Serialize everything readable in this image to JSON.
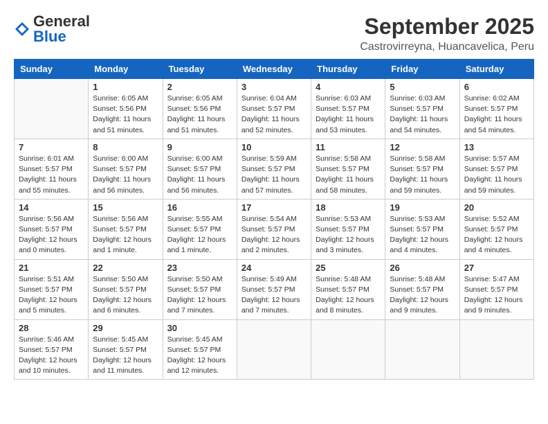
{
  "logo": {
    "general": "General",
    "blue": "Blue"
  },
  "header": {
    "month": "September 2025",
    "location": "Castrovirreyna, Huancavelica, Peru"
  },
  "weekdays": [
    "Sunday",
    "Monday",
    "Tuesday",
    "Wednesday",
    "Thursday",
    "Friday",
    "Saturday"
  ],
  "weeks": [
    [
      {
        "day": "",
        "info": ""
      },
      {
        "day": "1",
        "info": "Sunrise: 6:05 AM\nSunset: 5:56 PM\nDaylight: 11 hours\nand 51 minutes."
      },
      {
        "day": "2",
        "info": "Sunrise: 6:05 AM\nSunset: 5:56 PM\nDaylight: 11 hours\nand 51 minutes."
      },
      {
        "day": "3",
        "info": "Sunrise: 6:04 AM\nSunset: 5:57 PM\nDaylight: 11 hours\nand 52 minutes."
      },
      {
        "day": "4",
        "info": "Sunrise: 6:03 AM\nSunset: 5:57 PM\nDaylight: 11 hours\nand 53 minutes."
      },
      {
        "day": "5",
        "info": "Sunrise: 6:03 AM\nSunset: 5:57 PM\nDaylight: 11 hours\nand 54 minutes."
      },
      {
        "day": "6",
        "info": "Sunrise: 6:02 AM\nSunset: 5:57 PM\nDaylight: 11 hours\nand 54 minutes."
      }
    ],
    [
      {
        "day": "7",
        "info": "Sunrise: 6:01 AM\nSunset: 5:57 PM\nDaylight: 11 hours\nand 55 minutes."
      },
      {
        "day": "8",
        "info": "Sunrise: 6:00 AM\nSunset: 5:57 PM\nDaylight: 11 hours\nand 56 minutes."
      },
      {
        "day": "9",
        "info": "Sunrise: 6:00 AM\nSunset: 5:57 PM\nDaylight: 11 hours\nand 56 minutes."
      },
      {
        "day": "10",
        "info": "Sunrise: 5:59 AM\nSunset: 5:57 PM\nDaylight: 11 hours\nand 57 minutes."
      },
      {
        "day": "11",
        "info": "Sunrise: 5:58 AM\nSunset: 5:57 PM\nDaylight: 11 hours\nand 58 minutes."
      },
      {
        "day": "12",
        "info": "Sunrise: 5:58 AM\nSunset: 5:57 PM\nDaylight: 11 hours\nand 59 minutes."
      },
      {
        "day": "13",
        "info": "Sunrise: 5:57 AM\nSunset: 5:57 PM\nDaylight: 11 hours\nand 59 minutes."
      }
    ],
    [
      {
        "day": "14",
        "info": "Sunrise: 5:56 AM\nSunset: 5:57 PM\nDaylight: 12 hours\nand 0 minutes."
      },
      {
        "day": "15",
        "info": "Sunrise: 5:56 AM\nSunset: 5:57 PM\nDaylight: 12 hours\nand 1 minute."
      },
      {
        "day": "16",
        "info": "Sunrise: 5:55 AM\nSunset: 5:57 PM\nDaylight: 12 hours\nand 1 minute."
      },
      {
        "day": "17",
        "info": "Sunrise: 5:54 AM\nSunset: 5:57 PM\nDaylight: 12 hours\nand 2 minutes."
      },
      {
        "day": "18",
        "info": "Sunrise: 5:53 AM\nSunset: 5:57 PM\nDaylight: 12 hours\nand 3 minutes."
      },
      {
        "day": "19",
        "info": "Sunrise: 5:53 AM\nSunset: 5:57 PM\nDaylight: 12 hours\nand 4 minutes."
      },
      {
        "day": "20",
        "info": "Sunrise: 5:52 AM\nSunset: 5:57 PM\nDaylight: 12 hours\nand 4 minutes."
      }
    ],
    [
      {
        "day": "21",
        "info": "Sunrise: 5:51 AM\nSunset: 5:57 PM\nDaylight: 12 hours\nand 5 minutes."
      },
      {
        "day": "22",
        "info": "Sunrise: 5:50 AM\nSunset: 5:57 PM\nDaylight: 12 hours\nand 6 minutes."
      },
      {
        "day": "23",
        "info": "Sunrise: 5:50 AM\nSunset: 5:57 PM\nDaylight: 12 hours\nand 7 minutes."
      },
      {
        "day": "24",
        "info": "Sunrise: 5:49 AM\nSunset: 5:57 PM\nDaylight: 12 hours\nand 7 minutes."
      },
      {
        "day": "25",
        "info": "Sunrise: 5:48 AM\nSunset: 5:57 PM\nDaylight: 12 hours\nand 8 minutes."
      },
      {
        "day": "26",
        "info": "Sunrise: 5:48 AM\nSunset: 5:57 PM\nDaylight: 12 hours\nand 9 minutes."
      },
      {
        "day": "27",
        "info": "Sunrise: 5:47 AM\nSunset: 5:57 PM\nDaylight: 12 hours\nand 9 minutes."
      }
    ],
    [
      {
        "day": "28",
        "info": "Sunrise: 5:46 AM\nSunset: 5:57 PM\nDaylight: 12 hours\nand 10 minutes."
      },
      {
        "day": "29",
        "info": "Sunrise: 5:45 AM\nSunset: 5:57 PM\nDaylight: 12 hours\nand 11 minutes."
      },
      {
        "day": "30",
        "info": "Sunrise: 5:45 AM\nSunset: 5:57 PM\nDaylight: 12 hours\nand 12 minutes."
      },
      {
        "day": "",
        "info": ""
      },
      {
        "day": "",
        "info": ""
      },
      {
        "day": "",
        "info": ""
      },
      {
        "day": "",
        "info": ""
      }
    ]
  ]
}
